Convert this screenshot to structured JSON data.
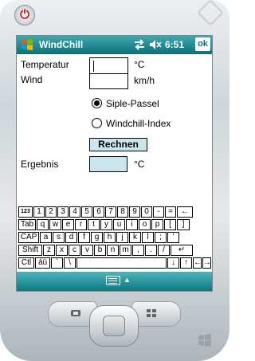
{
  "statusbar": {
    "title": "WindChill",
    "time": "6:51",
    "ok_label": "ok"
  },
  "form": {
    "temperature_label": "Temperatur",
    "temperature_unit": "°C",
    "temperature_value": "",
    "wind_label": "Wind",
    "wind_unit": "km/h",
    "wind_value": "",
    "radio_siple": "Siple-Passel",
    "radio_windchill": "Windchill-Index",
    "selected_method": "Siple-Passel",
    "calc_button": "Rechnen",
    "result_label": "Ergebnis",
    "result_unit": "°C",
    "result_value": ""
  },
  "keyboard": {
    "rows": [
      [
        "123",
        "1",
        "2",
        "3",
        "4",
        "5",
        "6",
        "7",
        "8",
        "9",
        "0",
        "-",
        "=",
        "←"
      ],
      [
        "Tab",
        "q",
        "w",
        "e",
        "r",
        "t",
        "y",
        "u",
        "i",
        "o",
        "p",
        "[",
        "]"
      ],
      [
        "CAP",
        "a",
        "s",
        "d",
        "f",
        "g",
        "h",
        "j",
        "k",
        "l",
        ";",
        "'"
      ],
      [
        "Shift",
        "z",
        "x",
        "c",
        "v",
        "b",
        "n",
        "m",
        ",",
        ".",
        "/",
        "↵"
      ],
      [
        "Ctl",
        "áü",
        "`",
        "\\",
        "",
        "↓",
        "↑",
        "←",
        "→"
      ]
    ]
  },
  "icons": {
    "start": "windows-flag-icon",
    "network": "network-arrows-icon",
    "volume": "speaker-muted-icon",
    "keyboard_toggle": "keyboard-icon"
  },
  "colors": {
    "titlebar": "#0a7179",
    "button_fill": "#c8e6ec"
  }
}
